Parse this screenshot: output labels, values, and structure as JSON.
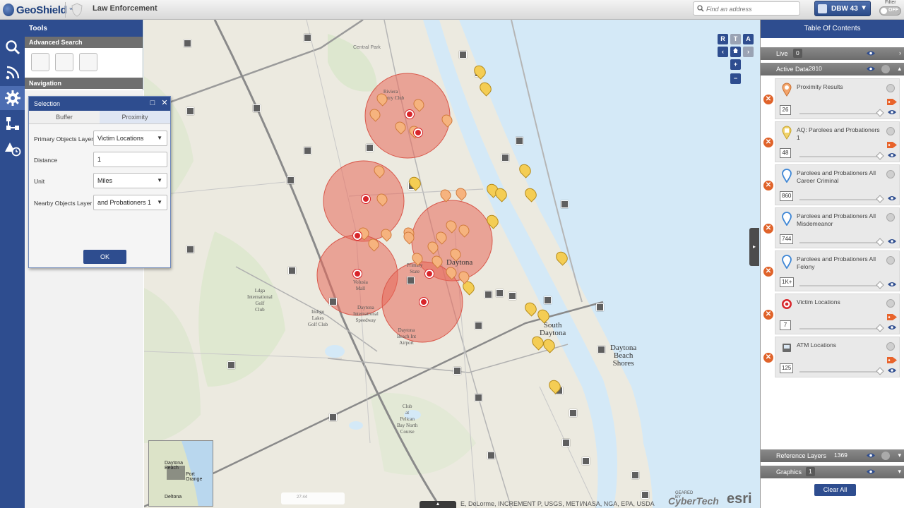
{
  "header": {
    "logo_text": "GeoShield",
    "logo_tm": "™",
    "module_title": "Law Enforcement",
    "address_placeholder": "Find an address",
    "database_label": "DBW 43",
    "filter_label": "Filter",
    "filter_state": "OFF"
  },
  "left_rail": {
    "items": [
      {
        "icon": "search-icon"
      },
      {
        "icon": "live-feed-icon"
      },
      {
        "icon": "gear-icon",
        "active": true
      },
      {
        "icon": "network-icon"
      },
      {
        "icon": "alert-clock-icon"
      }
    ]
  },
  "tools": {
    "title": "Tools",
    "advanced_search_label": "Advanced Search",
    "navigation_label": "Navigation"
  },
  "selection_dialog": {
    "title": "Selection",
    "tabs": [
      "Buffer",
      "Proximity"
    ],
    "active_tab": "Proximity",
    "fields": {
      "primary_label": "Primary Objects Layer",
      "primary_value": "Victim Locations",
      "distance_label": "Distance",
      "distance_value": "1",
      "unit_label": "Unit",
      "unit_value": "Miles",
      "nearby_label": "Nearby Objects Layer",
      "nearby_value": "and Probationers 1"
    },
    "ok_label": "OK"
  },
  "map": {
    "controls": [
      "R",
      "T",
      "A"
    ],
    "zoom_in": "+",
    "zoom_out": "−",
    "labels": {
      "daytona": "Daytona",
      "south_daytona": "South\nDaytona",
      "daytona_beach_shores": "Daytona\nBeach\nShores",
      "ormond": "Riviera\nCountry Club",
      "ldga": "Ldga\nInternational\nGolf\nClub",
      "indigo": "Indigo\nLakes\nGolf Club",
      "speedway": "Daytona\nInternational\nSpeedway",
      "volusia_mall": "Volusia\nMall",
      "airport": "Daytona\nBeach Int\nAirport",
      "pelican_bay": "Club\nat\nPelican\nBay North\nCourse",
      "central_park": "Central\nPark",
      "primary_state": "Primary\nState"
    },
    "minimap_labels": {
      "daytona_beach": "Daytona\nBeach",
      "port_orange": "Port\nOrange",
      "deltona": "Deltona"
    },
    "media_time": "27:44",
    "attribution": "E, DeLorme, INCREMENT P, USGS, METI/NASA, NGA, EPA, USDA",
    "geared_by": "GEARED BY",
    "cybertech": "CyberTech",
    "esri": "esri"
  },
  "toc": {
    "title": "Table Of Contents",
    "live_label": "Live",
    "live_count": "0",
    "active_label": "Active Data",
    "active_count": "2810",
    "layers": [
      {
        "name": "Proximity Results",
        "count": "26",
        "icon": "proximity-pin-icon",
        "tagged": true
      },
      {
        "name": "AQ: Parolees and Probationers 1",
        "count": "48",
        "icon": "parolee-pin-icon",
        "tagged": true
      },
      {
        "name": "Parolees and Probationers All Career Criminal",
        "count": "860",
        "icon": "blue-pin-icon",
        "tagged": false
      },
      {
        "name": "Parolees and Probationers All Misdemeanor",
        "count": "744",
        "icon": "blue-pin-icon",
        "tagged": false
      },
      {
        "name": "Parolees and Probationers All Felony",
        "count": "1K+",
        "icon": "blue-pin-icon",
        "tagged": false
      },
      {
        "name": "Victim Locations",
        "count": "7",
        "icon": "target-icon",
        "tagged": true
      },
      {
        "name": "ATM Locations",
        "count": "125",
        "icon": "atm-icon",
        "tagged": true
      }
    ],
    "reference_label": "Reference Layers",
    "reference_count": "1369",
    "graphics_label": "Graphics",
    "graphics_count": "1",
    "clear_label": "Clear All"
  },
  "colors": {
    "brand_blue": "#2e4d8f",
    "buffer_fill": "#e8685a",
    "water": "#d4e9f7",
    "remove_orange": "#e0632a"
  }
}
